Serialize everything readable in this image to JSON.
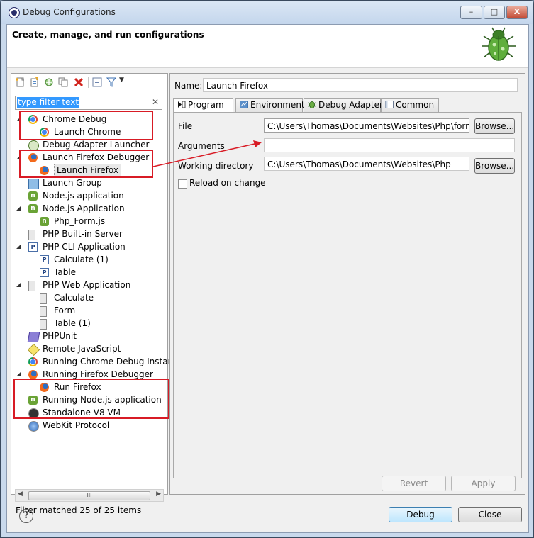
{
  "window": {
    "title": "Debug Configurations",
    "minimize": "–",
    "maximize": "□",
    "close": "X"
  },
  "header": {
    "title": "Create, manage, and run configurations"
  },
  "filter": {
    "text": "type filter text",
    "clear": "✕"
  },
  "tree": [
    {
      "label": "Chrome Debug",
      "icon": "chrome",
      "level": 0,
      "expanded": true
    },
    {
      "label": "Launch Chrome",
      "icon": "chrome",
      "level": 1
    },
    {
      "label": "Debug Adapter Launcher",
      "icon": "bug",
      "level": 0
    },
    {
      "label": "Launch Firefox Debugger",
      "icon": "firefox",
      "level": 0,
      "expanded": true
    },
    {
      "label": "Launch Firefox",
      "icon": "firefox",
      "level": 1,
      "selected": true
    },
    {
      "label": "Launch Group",
      "icon": "group",
      "level": 0
    },
    {
      "label": "Node.js application",
      "icon": "node",
      "level": 0
    },
    {
      "label": "Node.js Application",
      "icon": "node",
      "level": 0,
      "expanded": true
    },
    {
      "label": "Php_Form.js",
      "icon": "node",
      "level": 1
    },
    {
      "label": "PHP Built-in Server",
      "icon": "php-server",
      "level": 0
    },
    {
      "label": "PHP CLI Application",
      "icon": "php",
      "level": 0,
      "expanded": true
    },
    {
      "label": "Calculate (1)",
      "icon": "php",
      "level": 1
    },
    {
      "label": "Table",
      "icon": "php",
      "level": 1
    },
    {
      "label": "PHP Web Application",
      "icon": "php-server",
      "level": 0,
      "expanded": true
    },
    {
      "label": "Calculate",
      "icon": "php-server",
      "level": 1
    },
    {
      "label": "Form",
      "icon": "php-server",
      "level": 1
    },
    {
      "label": "Table (1)",
      "icon": "php-server",
      "level": 1
    },
    {
      "label": "PHPUnit",
      "icon": "phpunit",
      "level": 0
    },
    {
      "label": "Remote JavaScript",
      "icon": "js",
      "level": 0
    },
    {
      "label": "Running Chrome Debug Instanc",
      "icon": "chrome",
      "level": 0
    },
    {
      "label": "Running Firefox Debugger",
      "icon": "firefox",
      "level": 0,
      "expanded": true
    },
    {
      "label": "Run Firefox",
      "icon": "firefox",
      "level": 1
    },
    {
      "label": "Running Node.js application",
      "icon": "node",
      "level": 0
    },
    {
      "label": "Standalone V8 VM",
      "icon": "v8",
      "level": 0
    },
    {
      "label": "WebKit Protocol",
      "icon": "webkit",
      "level": 0
    }
  ],
  "status": "Filter matched 25 of 25 items",
  "scroll_grip": "III",
  "name_label": "Name:",
  "name_value": "Launch Firefox",
  "tabs": [
    {
      "label": "Program",
      "icon": "program",
      "active": true
    },
    {
      "label": "Environment",
      "icon": "environment"
    },
    {
      "label": "Debug Adapter",
      "icon": "debug-adapter"
    },
    {
      "label": "Common",
      "icon": "common"
    }
  ],
  "form": {
    "file_label": "File",
    "file_value": "C:\\Users\\Thomas\\Documents\\Websites\\Php\\form.ht",
    "arguments_label": "Arguments",
    "arguments_value": "",
    "workdir_label": "Working directory",
    "workdir_value": "C:\\Users\\Thomas\\Documents\\Websites\\Php",
    "browse": "Browse...",
    "reload_label": "Reload on change"
  },
  "buttons": {
    "revert": "Revert",
    "apply": "Apply",
    "debug": "Debug",
    "close": "Close"
  },
  "help_icon": "?"
}
